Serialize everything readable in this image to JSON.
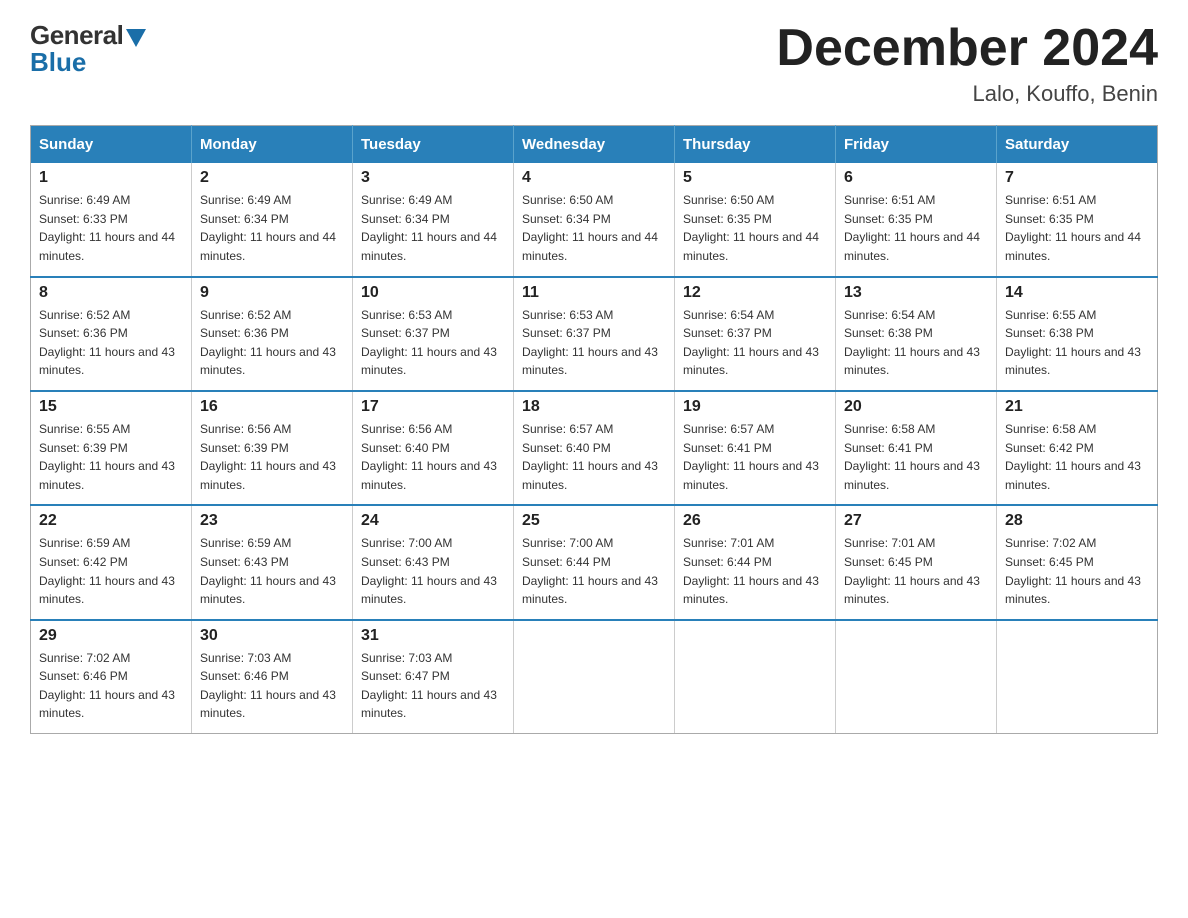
{
  "logo": {
    "general": "General",
    "blue": "Blue"
  },
  "title": {
    "month_year": "December 2024",
    "location": "Lalo, Kouffo, Benin"
  },
  "headers": [
    "Sunday",
    "Monday",
    "Tuesday",
    "Wednesday",
    "Thursday",
    "Friday",
    "Saturday"
  ],
  "weeks": [
    [
      {
        "day": "1",
        "sunrise": "6:49 AM",
        "sunset": "6:33 PM",
        "daylight": "11 hours and 44 minutes."
      },
      {
        "day": "2",
        "sunrise": "6:49 AM",
        "sunset": "6:34 PM",
        "daylight": "11 hours and 44 minutes."
      },
      {
        "day": "3",
        "sunrise": "6:49 AM",
        "sunset": "6:34 PM",
        "daylight": "11 hours and 44 minutes."
      },
      {
        "day": "4",
        "sunrise": "6:50 AM",
        "sunset": "6:34 PM",
        "daylight": "11 hours and 44 minutes."
      },
      {
        "day": "5",
        "sunrise": "6:50 AM",
        "sunset": "6:35 PM",
        "daylight": "11 hours and 44 minutes."
      },
      {
        "day": "6",
        "sunrise": "6:51 AM",
        "sunset": "6:35 PM",
        "daylight": "11 hours and 44 minutes."
      },
      {
        "day": "7",
        "sunrise": "6:51 AM",
        "sunset": "6:35 PM",
        "daylight": "11 hours and 44 minutes."
      }
    ],
    [
      {
        "day": "8",
        "sunrise": "6:52 AM",
        "sunset": "6:36 PM",
        "daylight": "11 hours and 43 minutes."
      },
      {
        "day": "9",
        "sunrise": "6:52 AM",
        "sunset": "6:36 PM",
        "daylight": "11 hours and 43 minutes."
      },
      {
        "day": "10",
        "sunrise": "6:53 AM",
        "sunset": "6:37 PM",
        "daylight": "11 hours and 43 minutes."
      },
      {
        "day": "11",
        "sunrise": "6:53 AM",
        "sunset": "6:37 PM",
        "daylight": "11 hours and 43 minutes."
      },
      {
        "day": "12",
        "sunrise": "6:54 AM",
        "sunset": "6:37 PM",
        "daylight": "11 hours and 43 minutes."
      },
      {
        "day": "13",
        "sunrise": "6:54 AM",
        "sunset": "6:38 PM",
        "daylight": "11 hours and 43 minutes."
      },
      {
        "day": "14",
        "sunrise": "6:55 AM",
        "sunset": "6:38 PM",
        "daylight": "11 hours and 43 minutes."
      }
    ],
    [
      {
        "day": "15",
        "sunrise": "6:55 AM",
        "sunset": "6:39 PM",
        "daylight": "11 hours and 43 minutes."
      },
      {
        "day": "16",
        "sunrise": "6:56 AM",
        "sunset": "6:39 PM",
        "daylight": "11 hours and 43 minutes."
      },
      {
        "day": "17",
        "sunrise": "6:56 AM",
        "sunset": "6:40 PM",
        "daylight": "11 hours and 43 minutes."
      },
      {
        "day": "18",
        "sunrise": "6:57 AM",
        "sunset": "6:40 PM",
        "daylight": "11 hours and 43 minutes."
      },
      {
        "day": "19",
        "sunrise": "6:57 AM",
        "sunset": "6:41 PM",
        "daylight": "11 hours and 43 minutes."
      },
      {
        "day": "20",
        "sunrise": "6:58 AM",
        "sunset": "6:41 PM",
        "daylight": "11 hours and 43 minutes."
      },
      {
        "day": "21",
        "sunrise": "6:58 AM",
        "sunset": "6:42 PM",
        "daylight": "11 hours and 43 minutes."
      }
    ],
    [
      {
        "day": "22",
        "sunrise": "6:59 AM",
        "sunset": "6:42 PM",
        "daylight": "11 hours and 43 minutes."
      },
      {
        "day": "23",
        "sunrise": "6:59 AM",
        "sunset": "6:43 PM",
        "daylight": "11 hours and 43 minutes."
      },
      {
        "day": "24",
        "sunrise": "7:00 AM",
        "sunset": "6:43 PM",
        "daylight": "11 hours and 43 minutes."
      },
      {
        "day": "25",
        "sunrise": "7:00 AM",
        "sunset": "6:44 PM",
        "daylight": "11 hours and 43 minutes."
      },
      {
        "day": "26",
        "sunrise": "7:01 AM",
        "sunset": "6:44 PM",
        "daylight": "11 hours and 43 minutes."
      },
      {
        "day": "27",
        "sunrise": "7:01 AM",
        "sunset": "6:45 PM",
        "daylight": "11 hours and 43 minutes."
      },
      {
        "day": "28",
        "sunrise": "7:02 AM",
        "sunset": "6:45 PM",
        "daylight": "11 hours and 43 minutes."
      }
    ],
    [
      {
        "day": "29",
        "sunrise": "7:02 AM",
        "sunset": "6:46 PM",
        "daylight": "11 hours and 43 minutes."
      },
      {
        "day": "30",
        "sunrise": "7:03 AM",
        "sunset": "6:46 PM",
        "daylight": "11 hours and 43 minutes."
      },
      {
        "day": "31",
        "sunrise": "7:03 AM",
        "sunset": "6:47 PM",
        "daylight": "11 hours and 43 minutes."
      },
      null,
      null,
      null,
      null
    ]
  ]
}
